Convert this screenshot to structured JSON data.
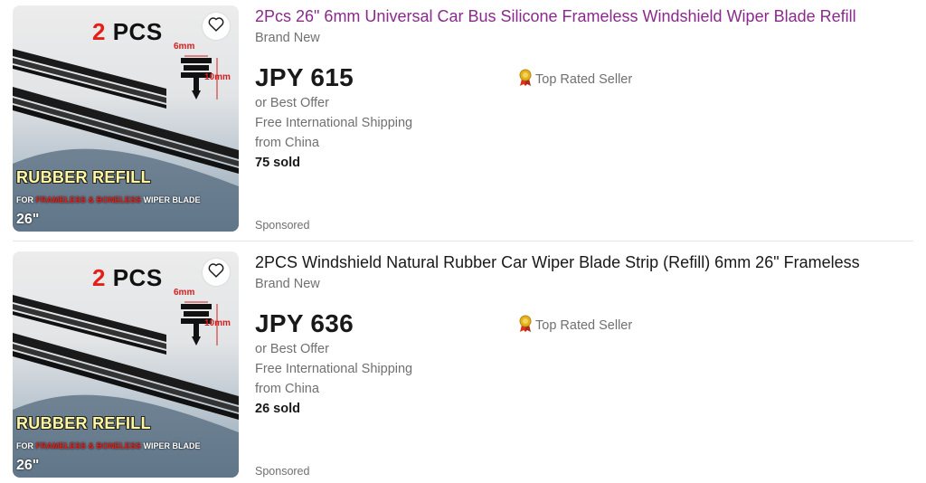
{
  "listings": [
    {
      "title": "2Pcs 26\" 6mm Universal Car Bus Silicone Frameless Windshield Wiper Blade Refill",
      "title_visited": true,
      "condition": "Brand New",
      "price": "JPY 615",
      "offer": "or Best Offer",
      "shipping": "Free International Shipping",
      "location": "from China",
      "sold": "75 sold",
      "seller_badge": "Top Rated Seller",
      "sponsored": "Sponsored",
      "image": {
        "pcs_num": "2",
        "pcs_text": "PCS",
        "width_label": "6mm",
        "height_label": "10mm",
        "headline": "RUBBER REFILL",
        "for_prefix": "FOR",
        "for_red": "FRAMELESS & BONELESS",
        "for_suffix": "WIPER BLADE",
        "size": "26\""
      }
    },
    {
      "title": "2PCS Windshield Natural Rubber Car Wiper Blade Strip (Refill) 6mm 26\" Frameless",
      "title_visited": false,
      "condition": "Brand New",
      "price": "JPY 636",
      "offer": "or Best Offer",
      "shipping": "Free International Shipping",
      "location": "from China",
      "sold": "26 sold",
      "seller_badge": "Top Rated Seller",
      "sponsored": "Sponsored",
      "image": {
        "pcs_num": "2",
        "pcs_text": "PCS",
        "width_label": "6mm",
        "height_label": "10mm",
        "headline": "RUBBER REFILL",
        "for_prefix": "FOR",
        "for_red": "FRAMELESS & BONELESS",
        "for_suffix": "WIPER BLADE",
        "size": "26\""
      }
    }
  ],
  "icons": {
    "watch": "heart-icon",
    "badge": "top-rated-medal-icon"
  },
  "colors": {
    "visited_link": "#8a2a8c",
    "text": "#191919",
    "muted": "#707070",
    "badge_gold": "#e3b21c",
    "badge_red": "#d6341f"
  }
}
